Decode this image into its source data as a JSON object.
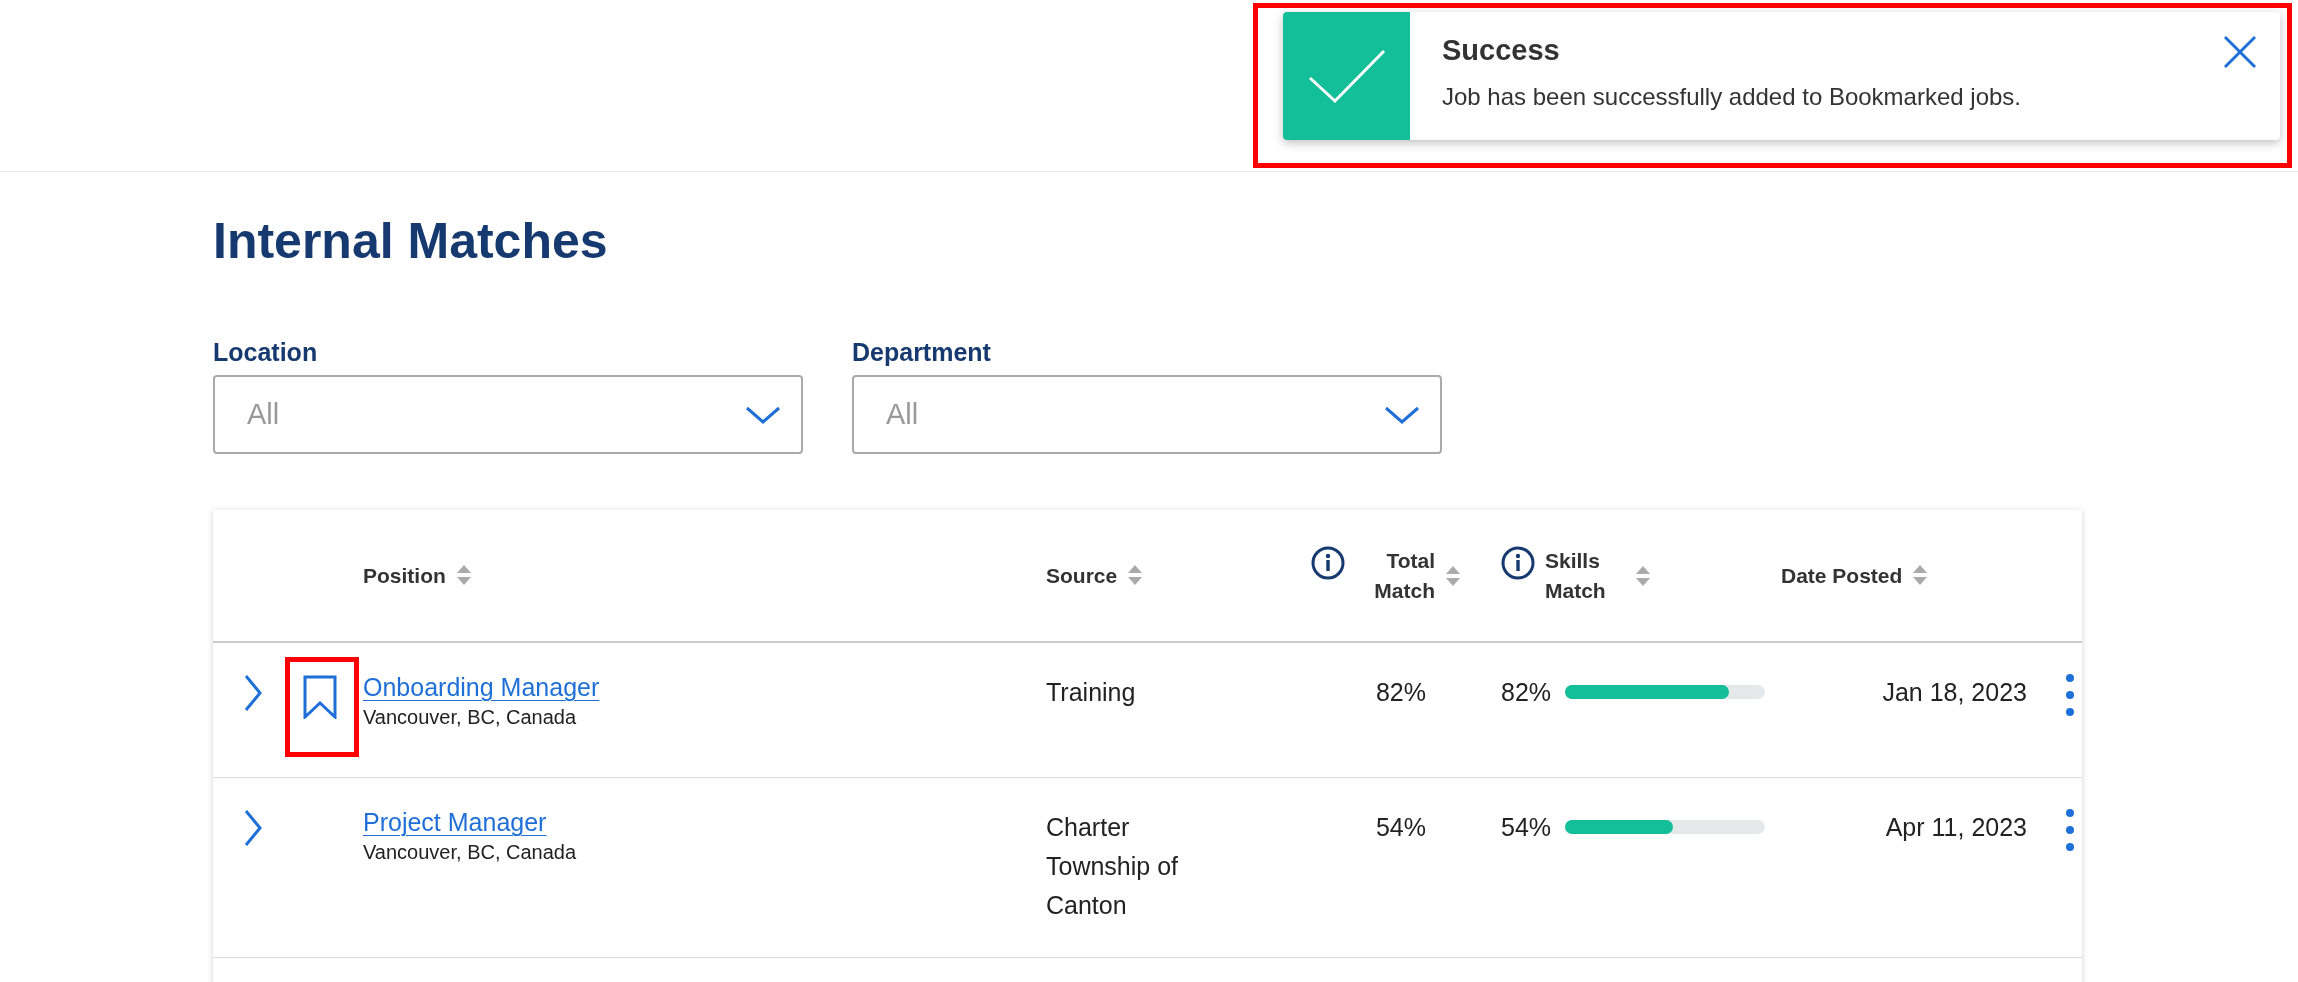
{
  "toast": {
    "kind": "success",
    "title": "Success",
    "message": "Job has been successfully added to Bookmarked jobs.",
    "highlighted": true
  },
  "title": "Internal Matches",
  "filters": [
    {
      "label": "Location",
      "value": "All"
    },
    {
      "label": "Department",
      "value": "All"
    }
  ],
  "table": {
    "columns": [
      {
        "label": "Position",
        "info": false
      },
      {
        "label": "Source",
        "info": false
      },
      {
        "label": "Total Match",
        "info": true
      },
      {
        "label": "Skills Match",
        "info": true
      },
      {
        "label": "Date Posted",
        "info": false
      }
    ],
    "rows": [
      {
        "position": "Onboarding Manager",
        "location": "Vancouver, BC, Canada",
        "source": "Training",
        "total_match": "82%",
        "skills_match": "82%",
        "level": 0.82,
        "date": "Jan 18, 2023",
        "bookmarked": true,
        "highlighted": true
      },
      {
        "position": "Project Manager",
        "location": "Vancouver, BC, Canada",
        "source": "Charter Township of Canton",
        "total_match": "54%",
        "skills_match": "54%",
        "level": 0.54,
        "date": "Apr 11, 2023",
        "bookmarked": false,
        "highlighted": false
      }
    ]
  }
}
